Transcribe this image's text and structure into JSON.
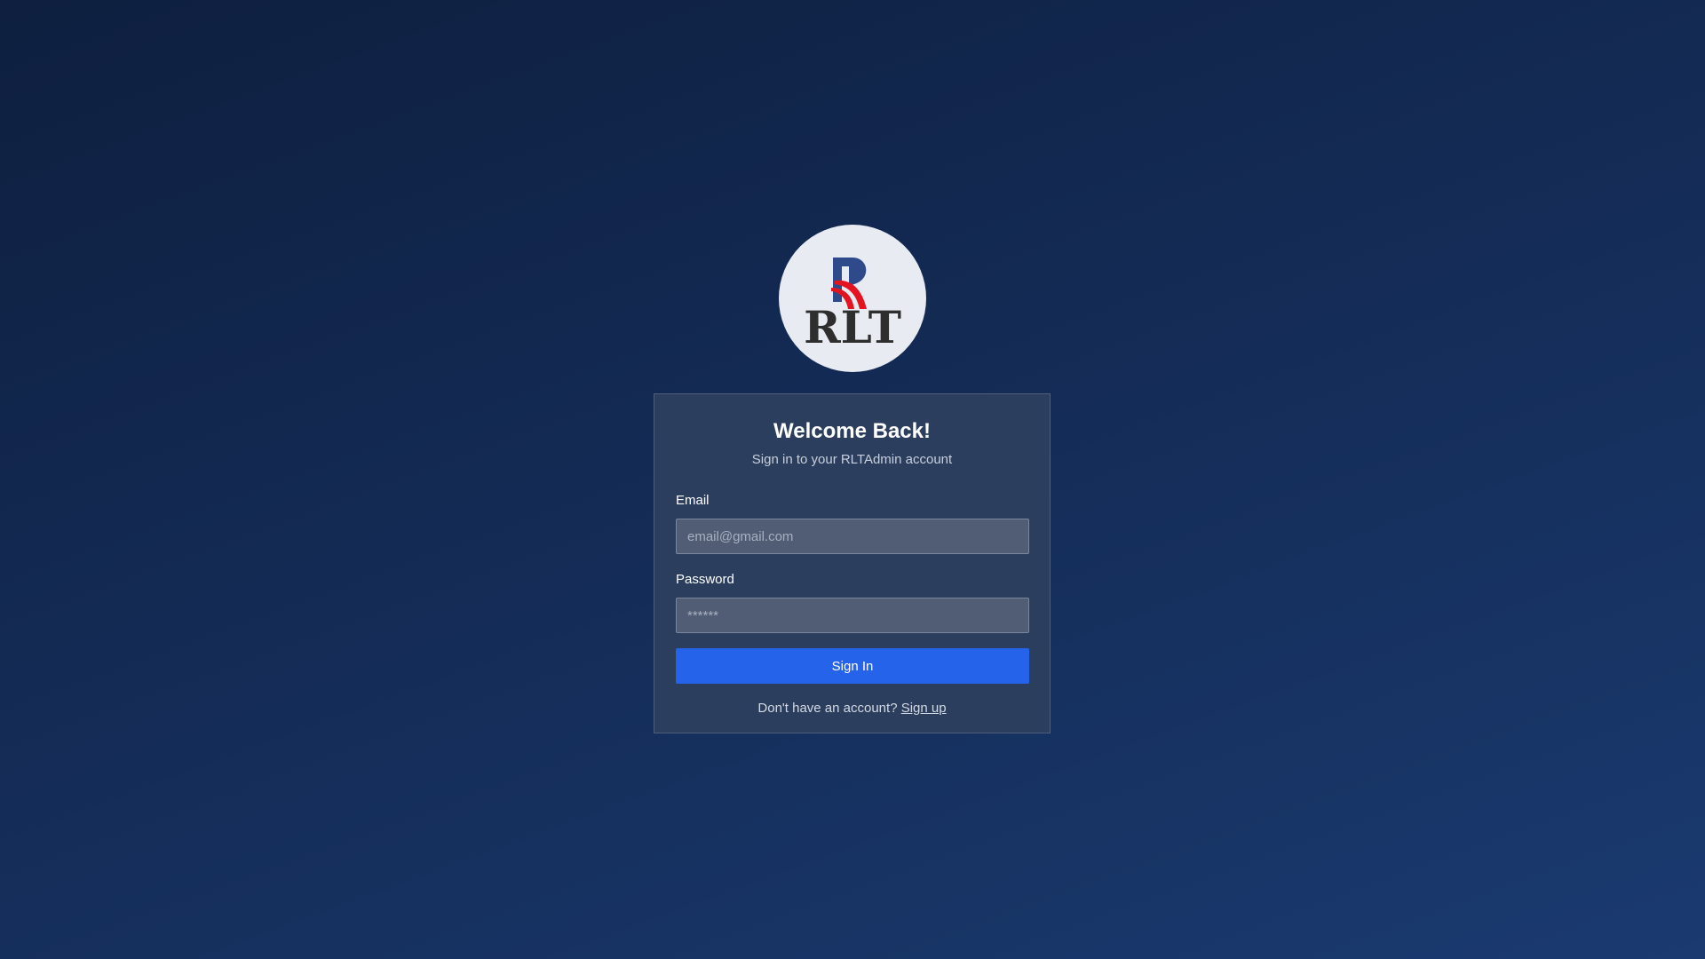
{
  "logo": {
    "text": "RLT",
    "icon": "rlt-logo-icon",
    "colors": {
      "dark": "#2e2e2e",
      "blue": "#2f4a8a",
      "red": "#e3141f"
    }
  },
  "login": {
    "title": "Welcome Back!",
    "subtitle": "Sign in to your RLTAdmin account",
    "email_label": "Email",
    "email_placeholder": "email@gmail.com",
    "email_value": "",
    "password_label": "Password",
    "password_placeholder": "******",
    "password_value": "",
    "submit_label": "Sign In",
    "footer_text": "Don't have an account?",
    "signup_link": "Sign up"
  },
  "colors": {
    "accent": "#2563eb",
    "card_bg": "#2c3e5e",
    "page_bg_start": "#0e1f3f",
    "page_bg_end": "#1a3a70"
  }
}
